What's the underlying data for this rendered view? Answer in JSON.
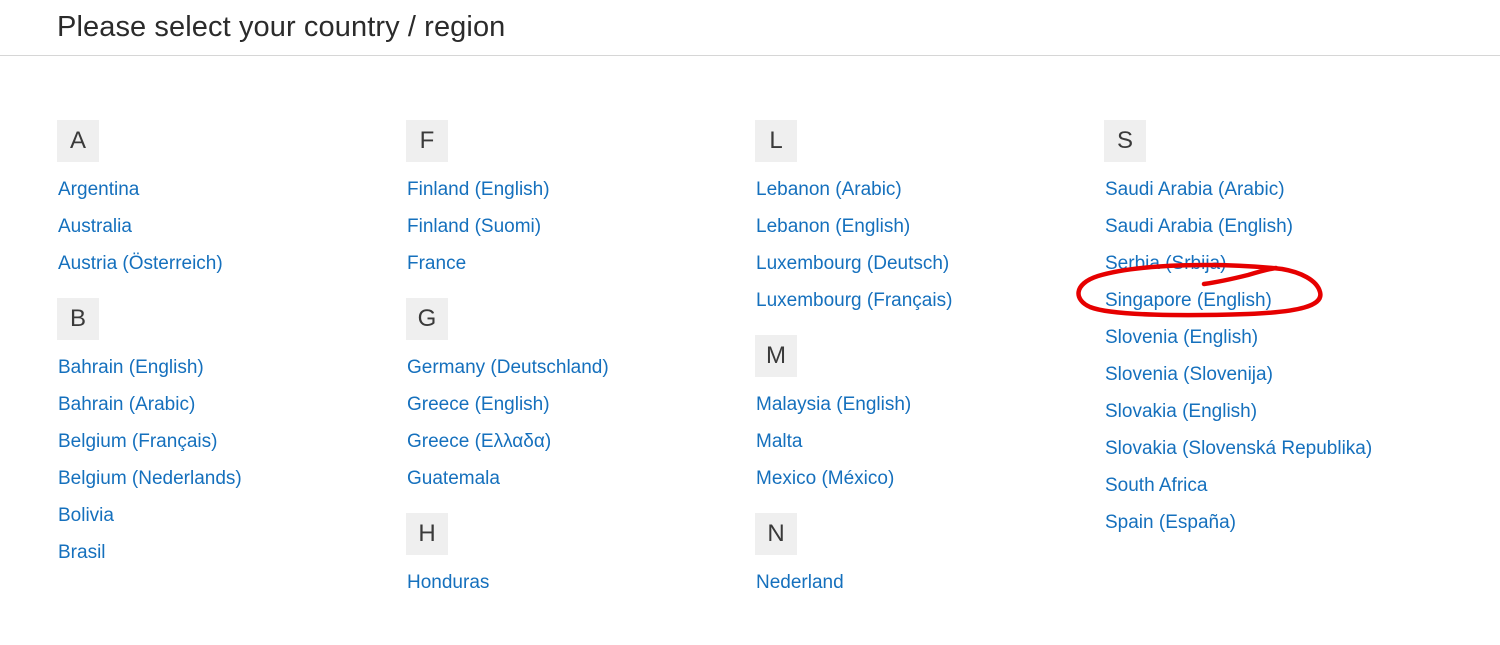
{
  "header": {
    "title": "Please select your country / region"
  },
  "annotation": {
    "type": "hand-drawn-ellipse",
    "color": "#e60000",
    "target_label": "Serbia (Srbija)"
  },
  "colors": {
    "link": "#1570bd",
    "letter_box_bg": "#efefef",
    "letter_text": "#3a3a3a",
    "title": "#2b2b2b",
    "divider": "#d6d6d6",
    "annotation_red": "#e60000"
  },
  "columns": [
    {
      "groups": [
        {
          "letter": "A",
          "items": [
            {
              "label": "Argentina"
            },
            {
              "label": "Australia"
            },
            {
              "label": "Austria (Österreich)"
            }
          ]
        },
        {
          "letter": "B",
          "items": [
            {
              "label": "Bahrain (English)"
            },
            {
              "label": "Bahrain (Arabic)"
            },
            {
              "label": "Belgium (Français)"
            },
            {
              "label": "Belgium (Nederlands)"
            },
            {
              "label": "Bolivia"
            },
            {
              "label": "Brasil"
            }
          ]
        }
      ]
    },
    {
      "groups": [
        {
          "letter": "F",
          "items": [
            {
              "label": "Finland (English)"
            },
            {
              "label": "Finland (Suomi)"
            },
            {
              "label": "France"
            }
          ]
        },
        {
          "letter": "G",
          "items": [
            {
              "label": "Germany (Deutschland)"
            },
            {
              "label": "Greece (English)"
            },
            {
              "label": "Greece (Ελλαδα)"
            },
            {
              "label": "Guatemala"
            }
          ]
        },
        {
          "letter": "H",
          "items": [
            {
              "label": "Honduras"
            }
          ]
        }
      ]
    },
    {
      "groups": [
        {
          "letter": "L",
          "items": [
            {
              "label": "Lebanon (Arabic)"
            },
            {
              "label": "Lebanon (English)"
            },
            {
              "label": "Luxembourg (Deutsch)"
            },
            {
              "label": "Luxembourg (Français)"
            }
          ]
        },
        {
          "letter": "M",
          "items": [
            {
              "label": "Malaysia (English)"
            },
            {
              "label": "Malta"
            },
            {
              "label": "Mexico (México)"
            }
          ]
        },
        {
          "letter": "N",
          "items": [
            {
              "label": "Nederland"
            }
          ]
        }
      ]
    },
    {
      "groups": [
        {
          "letter": "S",
          "items": [
            {
              "label": "Saudi Arabia (Arabic)"
            },
            {
              "label": "Saudi Arabia (English)"
            },
            {
              "label": "Serbia (Srbija)"
            },
            {
              "label": "Singapore (English)"
            },
            {
              "label": "Slovenia (English)"
            },
            {
              "label": "Slovenia (Slovenija)"
            },
            {
              "label": "Slovakia (English)"
            },
            {
              "label": "Slovakia (Slovenská Republika)"
            },
            {
              "label": "South Africa"
            },
            {
              "label": "Spain (España)"
            }
          ]
        }
      ]
    }
  ]
}
